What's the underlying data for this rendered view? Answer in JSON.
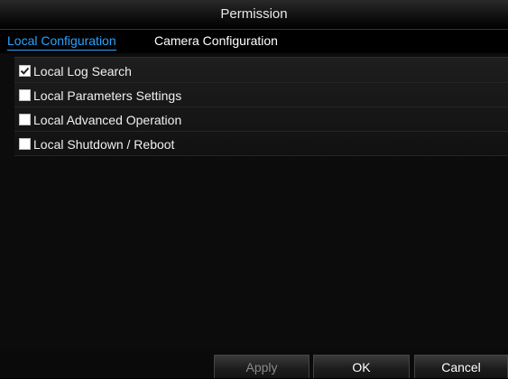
{
  "window": {
    "title": "Permission"
  },
  "tabs": [
    {
      "label": "Local Configuration",
      "active": true
    },
    {
      "label": "Camera Configuration",
      "active": false
    }
  ],
  "permissions": [
    {
      "label": "Local Log Search",
      "checked": true
    },
    {
      "label": "Local Parameters Settings",
      "checked": false
    },
    {
      "label": "Local Advanced Operation",
      "checked": false
    },
    {
      "label": "Local Shutdown / Reboot",
      "checked": false
    }
  ],
  "buttons": {
    "apply": {
      "label": "Apply",
      "enabled": false
    },
    "ok": {
      "label": "OK",
      "enabled": true
    },
    "cancel": {
      "label": "Cancel",
      "enabled": true
    }
  },
  "colors": {
    "active_tab": "#2aa3ff",
    "background": "#0b0b0b"
  }
}
